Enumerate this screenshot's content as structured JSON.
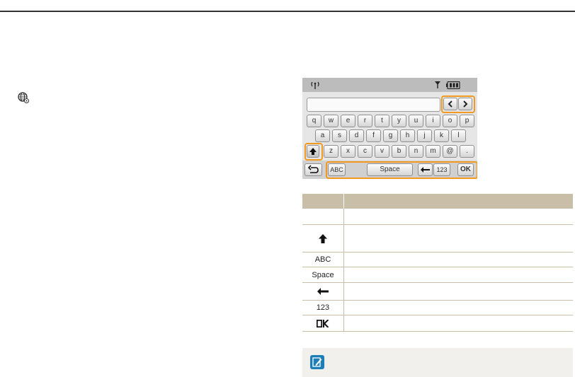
{
  "keyboard": {
    "row1": [
      "q",
      "w",
      "e",
      "r",
      "t",
      "y",
      "u",
      "i",
      "o",
      "p"
    ],
    "row2": [
      "a",
      "s",
      "d",
      "f",
      "g",
      "h",
      "j",
      "k",
      "l"
    ],
    "row3": [
      "z",
      "x",
      "c",
      "v",
      "b",
      "n",
      "m",
      "@",
      "."
    ],
    "mode_label": "ABC",
    "space_label": "Space",
    "num_label": "123",
    "ok_label": "OK"
  },
  "table": {
    "rows": [
      {
        "icon": "",
        "icon_name": "blank"
      },
      {
        "icon": "",
        "icon_name": "shift-arrow-icon"
      },
      {
        "icon": "ABC",
        "icon_name": "abc-text"
      },
      {
        "icon": "Space",
        "icon_name": "space-text"
      },
      {
        "icon": "",
        "icon_name": "backspace-arrow-icon"
      },
      {
        "icon": "123",
        "icon_name": "123-text"
      },
      {
        "icon": "",
        "icon_name": "ok-icon"
      }
    ]
  },
  "colors": {
    "accent": "#f29a1f",
    "table_header": "#c9bfa9",
    "note_icon": "#1e7fb6"
  }
}
